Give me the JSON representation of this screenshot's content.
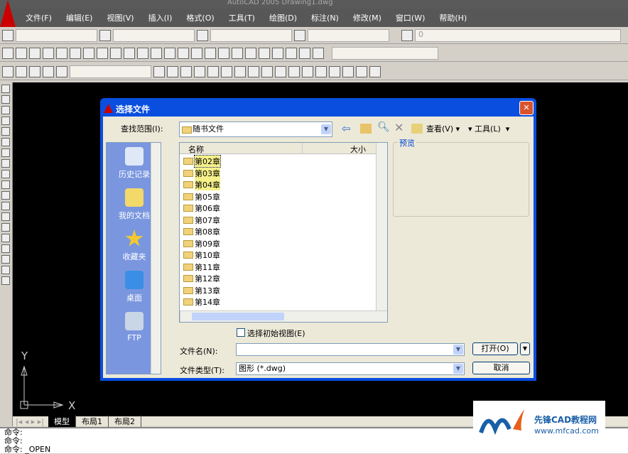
{
  "app": {
    "title": "AutoCAD 2005 Drawing1.dwg"
  },
  "menu": [
    "文件(F)",
    "编辑(E)",
    "视图(V)",
    "插入(I)",
    "格式(O)",
    "工具(T)",
    "绘图(D)",
    "标注(N)",
    "修改(M)",
    "窗口(W)",
    "帮助(H)"
  ],
  "layer": {
    "value": "0"
  },
  "tabs": [
    "模型",
    "布局1",
    "布局2"
  ],
  "active_tab": "模型",
  "command_lines": [
    "命令:",
    "命令:",
    "命令: _OPEN"
  ],
  "axis": {
    "x": "X",
    "y": "Y"
  },
  "dialog": {
    "title": "选择文件",
    "look_in_label": "查找范围(I):",
    "look_in_value": "随书文件",
    "views_label": "查看(V)",
    "tools_label": "工具(L)",
    "places": [
      "历史记录",
      "我的文档",
      "收藏夹",
      "桌面",
      "FTP"
    ],
    "columns": {
      "name": "名称",
      "size": "大小"
    },
    "files": [
      "第02章",
      "第03章",
      "第04章",
      "第05章",
      "第06章",
      "第07章",
      "第08章",
      "第09章",
      "第10章",
      "第11章",
      "第12章",
      "第13章",
      "第14章"
    ],
    "preview_label": "预览",
    "initial_view_label": "选择初始视图(E)",
    "initial_view_checked": false,
    "filename_label": "文件名(N):",
    "filename_value": "",
    "filetype_label": "文件类型(T):",
    "filetype_value": "图形 (*.dwg)",
    "open_label": "打开(O)",
    "cancel_label": "取消"
  },
  "watermark": {
    "text": "先锋CAD教程网",
    "url": "www.mfcad.com"
  }
}
